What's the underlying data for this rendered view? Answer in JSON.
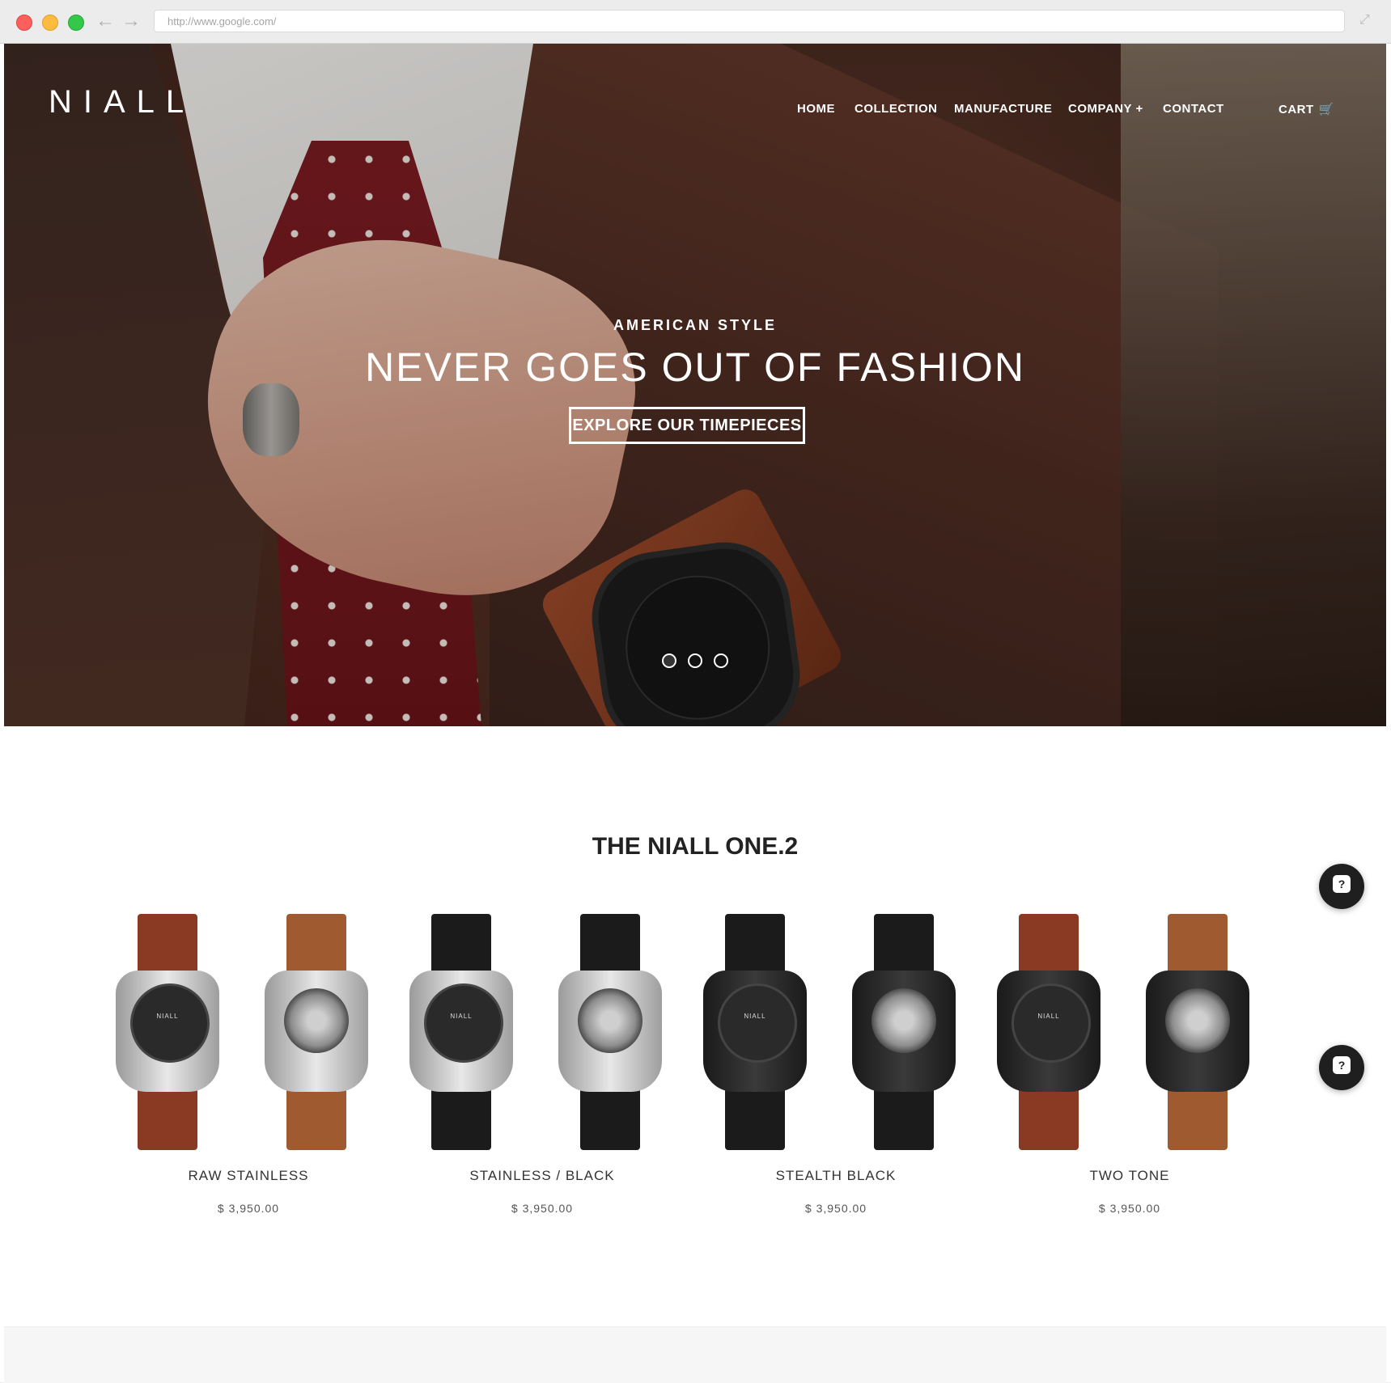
{
  "browser": {
    "url": "http://www.google.com/"
  },
  "brand": {
    "logo": "NIALL"
  },
  "nav": {
    "items": [
      {
        "label": "HOME"
      },
      {
        "label": "COLLECTION"
      },
      {
        "label": "MANUFACTURE"
      },
      {
        "label": "COMPANY +"
      },
      {
        "label": "CONTACT"
      }
    ],
    "cart": "CART"
  },
  "hero": {
    "subtitle": "AMERICAN STYLE",
    "title": "NEVER GOES OUT OF FASHION",
    "cta": "EXPLORE OUR TIMEPIECES",
    "slides_total": 3,
    "active_slide": 1
  },
  "collection": {
    "title": "THE NIALL ONE.2",
    "products": [
      {
        "name": "RAW STAINLESS",
        "price": "$ 3,950.00",
        "dial_label": "NIALL"
      },
      {
        "name": "STAINLESS / BLACK",
        "price": "$ 3,950.00",
        "dial_label": "NIALL"
      },
      {
        "name": "STEALTH BLACK",
        "price": "$ 3,950.00",
        "dial_label": "NIALL"
      },
      {
        "name": "TWO TONE",
        "price": "$ 3,950.00",
        "dial_label": "NIALL"
      }
    ]
  },
  "help": {
    "icon_label": "?"
  },
  "colors": {
    "text_dark": "#222222",
    "help_button": "#1f1f1f",
    "hero_text": "#ffffff"
  },
  "icons": [
    "back-arrow-icon",
    "forward-arrow-icon",
    "expand-icon",
    "cart-icon",
    "help-chat-icon"
  ]
}
